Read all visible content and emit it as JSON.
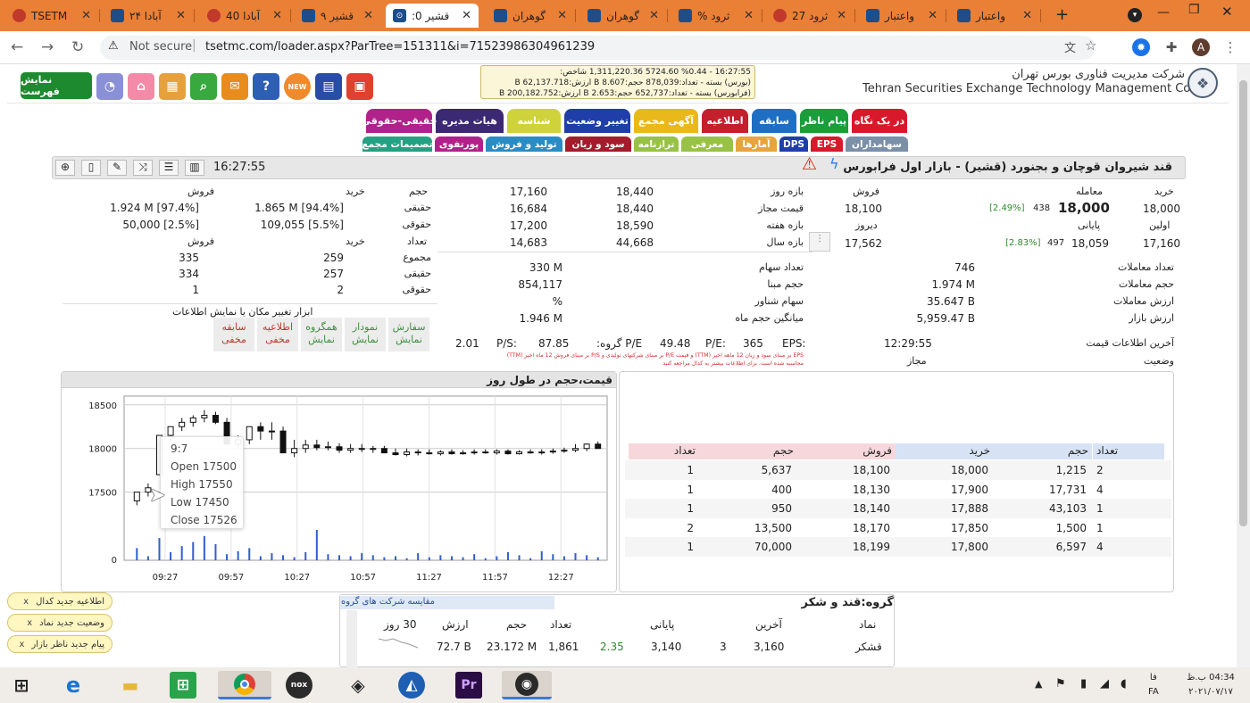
{
  "browser": {
    "tabs": [
      {
        "label": "TSETM"
      },
      {
        "label": "آبادا ۲۴"
      },
      {
        "label": "آبادا 40"
      },
      {
        "label": "قشیر ۹"
      },
      {
        "label": "قشیر 0:",
        "active": true
      },
      {
        "label": "گوهران"
      },
      {
        "label": "گوهران"
      },
      {
        "label": "ثرود %"
      },
      {
        "label": "ثرود 27"
      },
      {
        "label": "واعتبار"
      },
      {
        "label": "واعتبار"
      }
    ],
    "security_label": "Not secure",
    "url": "tsetmc.com/loader.aspx?ParTree=151311&i=7152398630496123​9",
    "profile_letter": "A"
  },
  "site": {
    "company_fa": "شرکت مدیریت فناوری بورس تهران",
    "company_en": "Tehran Securities Exchange Technology Management Co",
    "show_list_label": "نمایش فهرست",
    "new_badge": "NEW",
    "ticker": [
      "16:27:55 - %0.44 5724.60 1,311,220.36 شاخص:",
      "(بورس) بسته - تعداد:878,039 حجم:8.607 B ارزش:62,137.718 B",
      "(فرابورس) بسته - تعداد:652,737 حجم:2.653 B ارزش:200,182.752 B"
    ]
  },
  "menu": {
    "row1": [
      "در یک نگاه",
      "پیام ناظر",
      "سابقه",
      "اطلاعیه",
      "آگهی مجمع",
      "تغییر وضعیت",
      "شناسه",
      "هیات مدیره",
      "حقیقی-حقوقی"
    ],
    "row2": [
      "سهامداران",
      "EPS",
      "DPS",
      "آمارها",
      "معرفی",
      "ترازنامه",
      "سود و زیان",
      "تولید و فروش",
      "پورتفوی",
      "تصمیمات مجمع"
    ]
  },
  "symbol": {
    "title": "قند شیروان قوچان و بجنورد (قشیر) - بازار اول فرابورس",
    "time": "16:27:55"
  },
  "price": {
    "buy_label": "خرید",
    "trade_label": "معامله",
    "sell_label": "فروش",
    "last_buy": "18,000",
    "last_trade": "18,000",
    "last_change": "438",
    "last_pct": "[2.49%]",
    "last_sell": "18,100",
    "first_label": "اولین",
    "close_label": "پایانی",
    "yesterday_label": "دیروز",
    "first": "17,160",
    "close": "18,059",
    "close_change": "497",
    "close_pct": "[2.83%]",
    "yesterday": "17,562"
  },
  "ranges": {
    "rows": [
      {
        "label": "بازه روز",
        "a": "18,440",
        "b": "17,160"
      },
      {
        "label": "قیمت مجاز",
        "a": "18,440",
        "b": "16,684"
      },
      {
        "label": "بازه هفته",
        "a": "18,590",
        "b": "17,200"
      },
      {
        "label": "بازه سال",
        "a": "44,668",
        "b": "14,683"
      }
    ]
  },
  "stats": {
    "left": [
      {
        "label": "تعداد معاملات",
        "value": "746"
      },
      {
        "label": "حجم معاملات",
        "value": "1.974 M"
      },
      {
        "label": "ارزش معاملات",
        "value": "35.647 B"
      },
      {
        "label": "ارزش بازار",
        "value": "5,959.47 B"
      }
    ],
    "right": [
      {
        "label": "تعداد سهام",
        "value": "330 M"
      },
      {
        "label": "حجم مبنا",
        "value": "854,117"
      },
      {
        "label": "سهام شناور",
        "value": "%"
      },
      {
        "label": "میانگین حجم ماه",
        "value": "1.946 M"
      }
    ]
  },
  "info": {
    "last_info_label": "آخرین اطلاعات قیمت",
    "last_info_time": "12:29:55",
    "status_label": "وضعیت",
    "status_value": "مجاز",
    "eps_label": "EPS:",
    "eps": "365",
    "pe_label": "P/E:",
    "pe": "49.48",
    "gpe_label": "P/E گروه:",
    "gpe": "87.85",
    "ps_label": "P/S:",
    "ps": "2.01",
    "note1": "EPS بر مبنای سود و زیان 12 ماهه اخیر (TTM) و قیمت P/E بر مبنای شرکتهای تولیدی و P/S بر مبنای فروش 12 ماه اخیر (TTM)",
    "note2": "محاسبه شده است. برای اطلاعات بیشتر به کدال مراجعه کنید"
  },
  "investors": {
    "headers": {
      "buy": "خرید",
      "sell": "فروش",
      "volume": "حجم",
      "count": "تعداد"
    },
    "volume": [
      {
        "label": "حقیقی",
        "buy": "1.865 M [94.4%]",
        "sell": "1.924 M [97.4%]"
      },
      {
        "label": "حقوقی",
        "buy": "109,055 [5.5%]",
        "sell": "50,000 [2.5%]"
      }
    ],
    "count": [
      {
        "label": "مجموع",
        "buy": "259",
        "sell": "335"
      },
      {
        "label": "حقیقی",
        "buy": "257",
        "sell": "334"
      },
      {
        "label": "حقوقی",
        "buy": "2",
        "sell": "1"
      }
    ]
  },
  "tools": {
    "caption": "ابزار تغییر مکان یا نمایش اطلاعات",
    "tags": [
      {
        "top": "سفارش",
        "bottom": "نمایش",
        "tone": "green"
      },
      {
        "top": "نمودار",
        "bottom": "نمایش",
        "tone": "green"
      },
      {
        "top": "همگروه",
        "bottom": "نمایش",
        "tone": "green"
      },
      {
        "top": "اطلاعیه",
        "bottom": "مخفی",
        "tone": "red"
      },
      {
        "top": "سابقه",
        "bottom": "مخفی",
        "tone": "red"
      }
    ]
  },
  "orderbook": {
    "headers": [
      "تعداد",
      "حجم",
      "خرید",
      "فروش",
      "حجم",
      "تعداد"
    ],
    "rows": [
      [
        "2",
        "1,215",
        "18,000",
        "18,100",
        "5,637",
        "1"
      ],
      [
        "4",
        "17,731",
        "17,900",
        "18,130",
        "400",
        "1"
      ],
      [
        "1",
        "43,103",
        "17,888",
        "18,140",
        "950",
        "1"
      ],
      [
        "1",
        "1,500",
        "17,850",
        "18,170",
        "13,500",
        "2"
      ],
      [
        "4",
        "6,597",
        "17,800",
        "18,199",
        "70,000",
        "1"
      ]
    ]
  },
  "chart_data": {
    "type": "candlestick",
    "title": "قیمت،حجم در طول روز",
    "ylim": [
      17200,
      18600
    ],
    "yticks": [
      17500,
      18000,
      18500
    ],
    "xticks": [
      "09:27",
      "09:57",
      "10:27",
      "10:57",
      "11:27",
      "11:57",
      "12:27"
    ],
    "volume_tick": "0",
    "x": [
      "09:00",
      "09:05",
      "09:10",
      "09:15",
      "09:20",
      "09:25",
      "09:30",
      "09:35",
      "09:40",
      "09:45",
      "09:50",
      "09:55",
      "10:00",
      "10:05",
      "10:10",
      "10:15",
      "10:20",
      "10:25",
      "10:30",
      "10:35",
      "10:40",
      "10:45",
      "10:50",
      "10:55",
      "11:00",
      "11:05",
      "11:10",
      "11:15",
      "11:20",
      "11:25",
      "11:30",
      "11:35",
      "11:40",
      "11:45",
      "11:50",
      "11:55",
      "12:00",
      "12:05",
      "12:10",
      "12:15",
      "12:20",
      "12:25"
    ],
    "open": [
      17400,
      17500,
      17700,
      18150,
      18250,
      18300,
      18350,
      18380,
      18300,
      18050,
      18100,
      18250,
      18200,
      18200,
      17950,
      18000,
      18040,
      18010,
      18020,
      17980,
      18000,
      17990,
      18000,
      17950,
      17930,
      17960,
      17950,
      17940,
      17960,
      17940,
      17950,
      17960,
      17950,
      17970,
      17940,
      17960,
      17950,
      17960,
      17970,
      17980,
      18000,
      18050
    ],
    "high": [
      17500,
      17600,
      18100,
      18250,
      18350,
      18380,
      18440,
      18420,
      18350,
      18150,
      18200,
      18300,
      18300,
      18250,
      18100,
      18100,
      18100,
      18080,
      18060,
      18050,
      18050,
      18030,
      18030,
      18000,
      18000,
      17990,
      17990,
      17980,
      17990,
      17980,
      17990,
      17990,
      17990,
      17990,
      17980,
      17990,
      17990,
      18000,
      18010,
      18050,
      18060,
      18080
    ],
    "low": [
      17350,
      17450,
      17700,
      18100,
      18200,
      18250,
      18300,
      18280,
      18050,
      18000,
      18050,
      18100,
      18100,
      17950,
      17900,
      17950,
      17980,
      17980,
      17950,
      17950,
      17960,
      17950,
      17950,
      17920,
      17910,
      17920,
      17930,
      17920,
      17930,
      17930,
      17930,
      17940,
      17930,
      17930,
      17930,
      17940,
      17930,
      17940,
      17950,
      17960,
      17970,
      18000
    ],
    "close": [
      17500,
      17550,
      18150,
      18250,
      18300,
      18350,
      18380,
      18300,
      18050,
      18100,
      18250,
      18200,
      18200,
      17950,
      18000,
      18040,
      18010,
      18020,
      17980,
      18000,
      17990,
      18000,
      17950,
      17930,
      17960,
      17950,
      17940,
      17960,
      17940,
      17950,
      17960,
      17950,
      17970,
      17940,
      17960,
      17950,
      17960,
      17970,
      17980,
      18000,
      18050,
      18000
    ],
    "volume": [
      60,
      20,
      110,
      40,
      70,
      90,
      120,
      80,
      30,
      45,
      60,
      20,
      35,
      25,
      15,
      40,
      150,
      30,
      25,
      20,
      35,
      25,
      15,
      20,
      10,
      35,
      15,
      25,
      20,
      15,
      30,
      10,
      20,
      40,
      25,
      10,
      45,
      30,
      20,
      35,
      25,
      15
    ],
    "tooltip": {
      "time": "9:7",
      "open": "17500",
      "high": "17550",
      "low": "17450",
      "close": "17526"
    }
  },
  "group": {
    "title": "گروه:قند و شکر",
    "compare_link": "مقایسه شرکت های گروه",
    "headers": {
      "symbol": "نماد",
      "last": "آخرین",
      "close": "پایانی",
      "count": "تعداد",
      "volume": "حجم",
      "value": "ارزش",
      "days": "30 روز"
    },
    "row": {
      "symbol": "قشکر",
      "last": "3,160",
      "last_change": "3",
      "close": "3,140",
      "close_change": "2.35",
      "count": "1,861",
      "volume": "23.172 M",
      "value": "72.7 B"
    }
  },
  "notifications": [
    "اطلاعیه جدید کدال",
    "وضعیت جدید نماد",
    "پیام جدید ناظر بازار"
  ],
  "taskbar": {
    "lang": "FA",
    "time": "04:34 ب.ظ",
    "date": "۲۰۲۱/۰۷/۱۷"
  }
}
